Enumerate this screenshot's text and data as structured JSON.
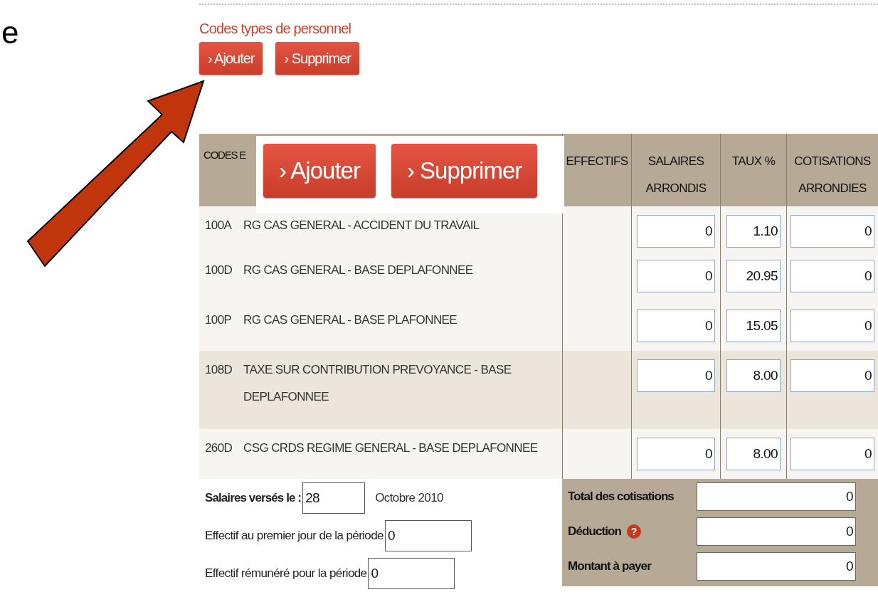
{
  "slide_text": "e",
  "section_title": "Codes types de personnel",
  "buttons": [
    {
      "label": "› Ajouter"
    },
    {
      "label": "› Supprimer"
    }
  ],
  "zoom_inset": {
    "buttons": [
      {
        "label": "› Ajouter"
      },
      {
        "label": "› Supprimer"
      }
    ]
  },
  "table": {
    "columns": [
      "CODES E",
      "EFFECTIFS",
      "SALAIRES ARRONDIS",
      "TAUX %",
      "COTISATIONS ARRONDIES"
    ],
    "rows": [
      {
        "code": "100A",
        "label": "RG CAS GENERAL - ACCIDENT DU TRAVAIL",
        "salaires": "0",
        "taux": "1.10",
        "cotisations": "0",
        "highlighted": false
      },
      {
        "code": "100D",
        "label": "RG CAS GENERAL - BASE DEPLAFONNEE",
        "salaires": "0",
        "taux": "20.95",
        "cotisations": "0",
        "highlighted": false
      },
      {
        "code": "100P",
        "label": "RG CAS GENERAL - BASE PLAFONNEE",
        "salaires": "0",
        "taux": "15.05",
        "cotisations": "0",
        "highlighted": false
      },
      {
        "code": "108D",
        "label": "TAXE SUR CONTRIBUTION PREVOYANCE - BASE DEPLAFONNEE",
        "salaires": "0",
        "taux": "8.00",
        "cotisations": "0",
        "highlighted": true
      },
      {
        "code": "260D",
        "label": "CSG CRDS REGIME GENERAL - BASE DEPLAFONNEE",
        "salaires": "0",
        "taux": "8.00",
        "cotisations": "0",
        "highlighted": false
      }
    ]
  },
  "form": [
    {
      "label": "Salaires versés le :",
      "value": "28",
      "suffix": "Octobre 2010",
      "bold": true
    },
    {
      "label": "Effectif au premier jour de la période",
      "value": "0",
      "bold": false
    },
    {
      "label": "Effectif rémunéré pour la période",
      "value": "0",
      "bold": false
    }
  ],
  "summary": [
    {
      "label": "Total des cotisations",
      "value": "0"
    },
    {
      "label": "Déduction",
      "value": "0",
      "help_icon": "?"
    },
    {
      "label": "Montant à payer",
      "value": "0"
    }
  ]
}
